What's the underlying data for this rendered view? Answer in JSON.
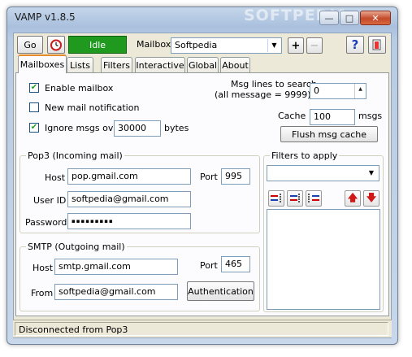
{
  "window": {
    "title": "VAMP v1.8.5",
    "watermark": "SOFTPEDIA"
  },
  "toolbar": {
    "go_label": "Go",
    "state_label": "Idle",
    "mailbox_label": "Mailbox",
    "mailbox_value": "Softpedia",
    "add_label": "+",
    "remove_label": "−",
    "help_label": "?"
  },
  "tabs": [
    "Mailboxes",
    "Lists",
    "Filters",
    "Interactive",
    "Global",
    "About"
  ],
  "mailboxes": {
    "enable_label": "Enable mailbox",
    "new_mail_label": "New mail notification",
    "ignore_label": "Ignore msgs over",
    "ignore_value": "30000",
    "ignore_unit": "bytes",
    "msg_lines_label1": "Msg lines to search",
    "msg_lines_label2": "(all message = 9999)",
    "msg_lines_value": "0",
    "cache_label": "Cache",
    "cache_value": "100",
    "cache_unit": "msgs",
    "flush_label": "Flush msg cache",
    "pop3": {
      "title": "Pop3 (Incoming mail)",
      "host_label": "Host",
      "host_value": "pop.gmail.com",
      "port_label": "Port",
      "port_value": "995",
      "userid_label": "User ID",
      "userid_value": "softpedia@gmail.com",
      "password_label": "Password",
      "password_value": "▪▪▪▪▪▪▪▪▪"
    },
    "smtp": {
      "title": "SMTP (Outgoing mail)",
      "host_label": "Host",
      "host_value": "smtp.gmail.com",
      "port_label": "Port",
      "port_value": "465",
      "from_label": "From",
      "from_value": "softpedia@gmail.com",
      "auth_label": "Authentication"
    },
    "filters": {
      "title": "Filters to apply",
      "select_value": ""
    }
  },
  "status": {
    "text": "Disconnected from Pop3"
  },
  "colors": {
    "idle": "#1f9a1f",
    "accent_arrow": "#d11818"
  }
}
